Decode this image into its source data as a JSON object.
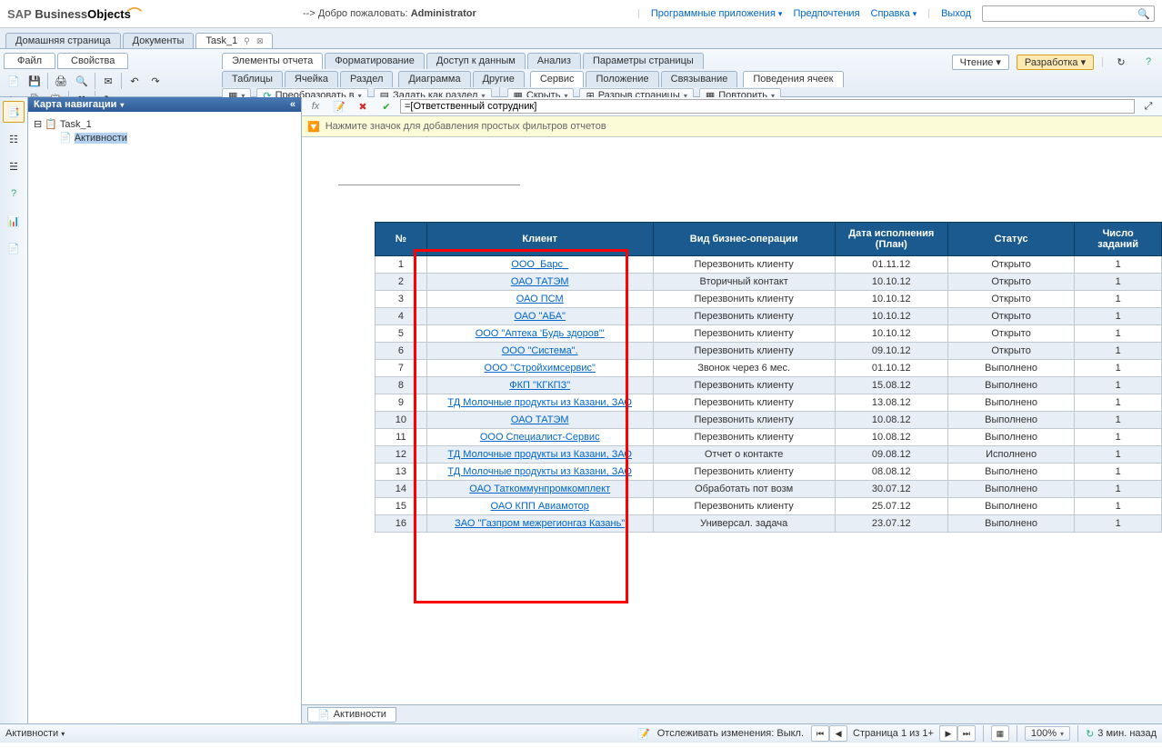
{
  "header": {
    "logo_sap": "SAP",
    "logo_business": "Business",
    "logo_objects": "Objects",
    "welcome": "--> Добро пожаловать:",
    "user": "Administrator",
    "links": {
      "apps": "Программные приложения",
      "prefs": "Предпочтения",
      "help": "Справка",
      "logout": "Выход"
    }
  },
  "top_tabs": {
    "home": "Домашняя страница",
    "docs": "Документы",
    "task": "Task_1"
  },
  "file_tabs": {
    "file": "Файл",
    "props": "Свойства"
  },
  "sub_tabs": {
    "elements": "Элементы отчета",
    "formatting": "Форматирование",
    "data_access": "Доступ к данным",
    "analysis": "Анализ",
    "page_params": "Параметры страницы"
  },
  "ribbon_groups": {
    "tables": "Таблицы",
    "cell": "Ячейка",
    "section": "Раздел",
    "diagram": "Диаграмма",
    "other": "Другие",
    "service": "Сервис",
    "position": "Положение",
    "linking": "Связывание",
    "cell_behavior": "Поведения ячеек"
  },
  "ribbon_buttons": {
    "transform": "Преобразовать в",
    "set_section": "Задать как раздел",
    "hide": "Скрыть",
    "page_break": "Разрыв страницы",
    "repeat": "Повторить"
  },
  "mode": {
    "read": "Чтение",
    "dev": "Разработка"
  },
  "nav_panel": {
    "title": "Карта навигации",
    "root": "Task_1",
    "child": "Активности"
  },
  "formula": "=[Ответственный сотрудник]",
  "filter_hint": "Нажмите значок для добавления простых фильтров отчетов",
  "table": {
    "headers": {
      "num": "№",
      "client": "Клиент",
      "operation": "Вид бизнес-операции",
      "date": "Дата исполнения (План)",
      "status": "Статус",
      "tasks": "Число заданий"
    },
    "rows": [
      {
        "n": "1",
        "client": "ООО_Барс_",
        "op": "Перезвонить клиенту",
        "date": "01.11.12",
        "status": "Открыто",
        "cnt": "1"
      },
      {
        "n": "2",
        "client": "ОАО ТАТЭМ",
        "op": "Вторичный контакт",
        "date": "10.10.12",
        "status": "Открыто",
        "cnt": "1"
      },
      {
        "n": "3",
        "client": "ОАО ПСМ",
        "op": "Перезвонить клиенту",
        "date": "10.10.12",
        "status": "Открыто",
        "cnt": "1"
      },
      {
        "n": "4",
        "client": "ОАО \"АБА\"",
        "op": "Перезвонить клиенту",
        "date": "10.10.12",
        "status": "Открыто",
        "cnt": "1"
      },
      {
        "n": "5",
        "client": "ООО \"Аптека 'Будь здоров'\"",
        "op": "Перезвонить клиенту",
        "date": "10.10.12",
        "status": "Открыто",
        "cnt": "1"
      },
      {
        "n": "6",
        "client": "ООО \"Система\".",
        "op": "Перезвонить клиенту",
        "date": "09.10.12",
        "status": "Открыто",
        "cnt": "1"
      },
      {
        "n": "7",
        "client": "ООО \"Стройхимсервис\"",
        "op": "Звонок через 6 мес.",
        "date": "01.10.12",
        "status": "Выполнено",
        "cnt": "1"
      },
      {
        "n": "8",
        "client": "ФКП \"КГКПЗ\"",
        "op": "Перезвонить клиенту",
        "date": "15.08.12",
        "status": "Выполнено",
        "cnt": "1"
      },
      {
        "n": "9",
        "client": "ТД Молочные продукты из Казани, ЗАО",
        "op": "Перезвонить клиенту",
        "date": "13.08.12",
        "status": "Выполнено",
        "cnt": "1"
      },
      {
        "n": "10",
        "client": "ОАО ТАТЭМ",
        "op": "Перезвонить клиенту",
        "date": "10.08.12",
        "status": "Выполнено",
        "cnt": "1"
      },
      {
        "n": "11",
        "client": "ООО Специалист-Сервис",
        "op": "Перезвонить клиенту",
        "date": "10.08.12",
        "status": "Выполнено",
        "cnt": "1"
      },
      {
        "n": "12",
        "client": "ТД Молочные продукты из Казани, ЗАО",
        "op": "Отчет о контакте",
        "date": "09.08.12",
        "status": "Исполнено",
        "cnt": "1"
      },
      {
        "n": "13",
        "client": "ТД Молочные продукты из Казани, ЗАО",
        "op": "Перезвонить клиенту",
        "date": "08.08.12",
        "status": "Выполнено",
        "cnt": "1"
      },
      {
        "n": "14",
        "client": "ОАО Таткоммунпромкомплект",
        "op": "Обработать пот возм",
        "date": "30.07.12",
        "status": "Выполнено",
        "cnt": "1"
      },
      {
        "n": "15",
        "client": "ОАО КПП Авиамотор",
        "op": "Перезвонить клиенту",
        "date": "25.07.12",
        "status": "Выполнено",
        "cnt": "1"
      },
      {
        "n": "16",
        "client": "ЗАО \"Газпром межрегионгаз Казань\"",
        "op": "Универсал. задача",
        "date": "23.07.12",
        "status": "Выполнено",
        "cnt": "1"
      }
    ]
  },
  "bottom_tab": "Активности",
  "status": {
    "activities": "Активности",
    "track": "Отслеживать изменения: Выкл.",
    "page": "Страница 1 из 1+",
    "zoom": "100%",
    "ago": "3 мин. назад"
  }
}
